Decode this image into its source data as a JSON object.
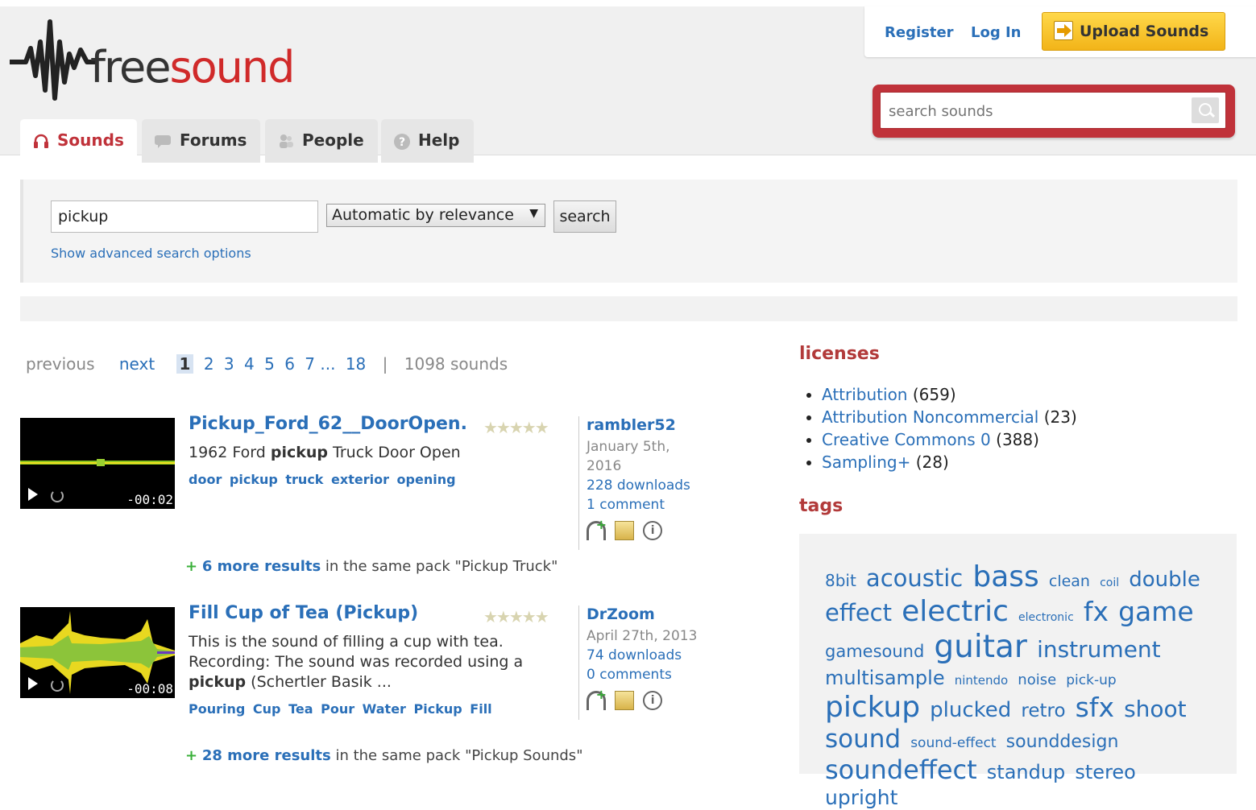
{
  "header": {
    "logo": {
      "free": "free",
      "sound": "sound"
    },
    "register": "Register",
    "login": "Log In",
    "upload": "Upload Sounds",
    "search_placeholder": "search sounds"
  },
  "tabs": [
    {
      "label": "Sounds",
      "icon": "headphones-icon",
      "active": true
    },
    {
      "label": "Forums",
      "icon": "speech-bubble-icon"
    },
    {
      "label": "People",
      "icon": "people-icon"
    },
    {
      "label": "Help",
      "icon": "question-icon"
    }
  ],
  "search": {
    "query": "pickup",
    "sort": "Automatic by relevance",
    "button": "search",
    "advanced": "Show advanced search options"
  },
  "pager": {
    "previous": "previous",
    "next": "next",
    "current": "1",
    "pages": [
      "2",
      "3",
      "4",
      "5",
      "6",
      "7"
    ],
    "ellipsis": "...",
    "last": "18",
    "sep": "|",
    "count": "1098 sounds"
  },
  "results": [
    {
      "title": "Pickup_Ford_62__DoorOpen.",
      "desc_before": "1962 Ford ",
      "desc_bold": "pickup",
      "desc_after": " Truck Door Open",
      "tags": [
        "door",
        "pickup",
        "truck",
        "exterior",
        "opening"
      ],
      "user": "rambler52",
      "date": "January 5th, 2016",
      "downloads": "228 downloads",
      "comments": "1 comment",
      "duration": "-00:02",
      "more_count": "6 more results",
      "more_text": " in the same pack \"Pickup Truck\""
    },
    {
      "title": "Fill Cup of Tea (Pickup)",
      "desc_before": "This is the sound of filling a cup with tea. Recording: The sound was recorded using a ",
      "desc_bold": "pickup",
      "desc_after": " (Schertler Basik ...",
      "tags": [
        "Pouring",
        "Cup",
        "Tea",
        "Pour",
        "Water",
        "Pickup",
        "Fill"
      ],
      "user": "DrZoom",
      "date": "April 27th, 2013",
      "downloads": "74 downloads",
      "comments": "0 comments",
      "duration": "-00:08",
      "more_count": "28 more results",
      "more_text": " in the same pack \"Pickup Sounds\""
    }
  ],
  "sidebar": {
    "licenses_title": "licenses",
    "licenses": [
      {
        "name": "Attribution",
        "count": "(659)"
      },
      {
        "name": "Attribution Noncommercial",
        "count": "(23)"
      },
      {
        "name": "Creative Commons 0",
        "count": "(388)"
      },
      {
        "name": "Sampling+",
        "count": "(28)"
      }
    ],
    "tags_title": "tags",
    "tags": [
      {
        "t": "8bit",
        "s": 20
      },
      {
        "t": "acoustic",
        "s": 29
      },
      {
        "t": "bass",
        "s": 36
      },
      {
        "t": "clean",
        "s": 19
      },
      {
        "t": "coil",
        "s": 14
      },
      {
        "t": "double",
        "s": 26
      },
      {
        "t": "effect",
        "s": 29
      },
      {
        "t": "electric",
        "s": 36
      },
      {
        "t": "electronic",
        "s": 14
      },
      {
        "t": "fx",
        "s": 33
      },
      {
        "t": "game",
        "s": 33
      },
      {
        "t": "gamesound",
        "s": 21
      },
      {
        "t": "guitar",
        "s": 39
      },
      {
        "t": "instrument",
        "s": 28
      },
      {
        "t": "multisample",
        "s": 24
      },
      {
        "t": "nintendo",
        "s": 15
      },
      {
        "t": "noise",
        "s": 18
      },
      {
        "t": "pick-up",
        "s": 17
      },
      {
        "t": "pickup",
        "s": 36
      },
      {
        "t": "plucked",
        "s": 26
      },
      {
        "t": "retro",
        "s": 23
      },
      {
        "t": "sfx",
        "s": 33
      },
      {
        "t": "shoot",
        "s": 28
      },
      {
        "t": "sound",
        "s": 31
      },
      {
        "t": "sound-effect",
        "s": 17
      },
      {
        "t": "sounddesign",
        "s": 22
      },
      {
        "t": "soundeffect",
        "s": 32
      },
      {
        "t": "standup",
        "s": 24
      },
      {
        "t": "stereo",
        "s": 24
      },
      {
        "t": "upright",
        "s": 25
      }
    ]
  },
  "colors": {
    "brand": "#d02a2a",
    "link": "#2a6fb8",
    "upload": "#f2b418"
  }
}
